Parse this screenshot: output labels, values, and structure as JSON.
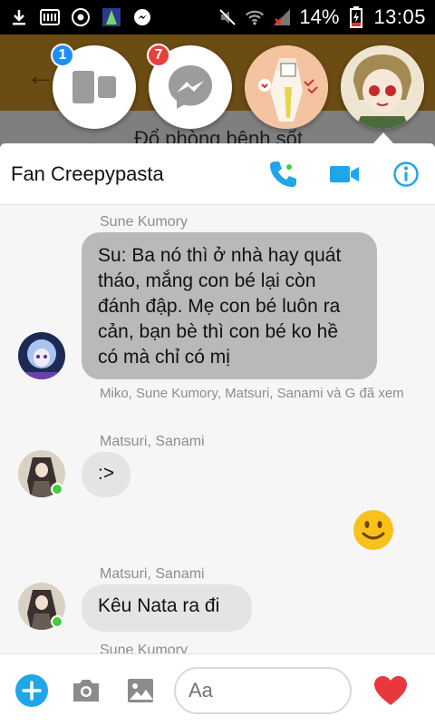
{
  "status_bar": {
    "battery_percent": "14%",
    "time": "13:05"
  },
  "background": {
    "subtitle": "Đổ phòng bệnh sốt"
  },
  "chat_heads": [
    {
      "name": "multiwindow",
      "badge": "1"
    },
    {
      "name": "messenger",
      "badge": "7"
    },
    {
      "name": "contact-anime-1"
    },
    {
      "name": "contact-anime-2"
    }
  ],
  "chat": {
    "title": "Fan Creepypasta"
  },
  "messages": {
    "m1_sender": "Sune Kumory",
    "m1_text": "Su: Ba nó thì ở nhà hay quát tháo, mắng con bé lại còn đánh đập. Mẹ con bé luôn ra cản, bạn bè thì con bé ko hề có mà chỉ có mị",
    "m1_seen": "Miko, Sune Kumory, Matsuri, Sanami và G đã xem",
    "m2_sender": "Matsuri, Sanami",
    "m2_text": ":>",
    "m3_sender": "Matsuri, Sanami",
    "m3_text": "Kêu Nata ra đi",
    "m4_sender": "Sune Kumory"
  },
  "composer": {
    "placeholder": "Aa"
  },
  "colors": {
    "accent": "#1fa6e8",
    "heart": "#e8383f",
    "bubble_gray": "#b9b9b9",
    "bubble_light": "#e4e4e4"
  }
}
